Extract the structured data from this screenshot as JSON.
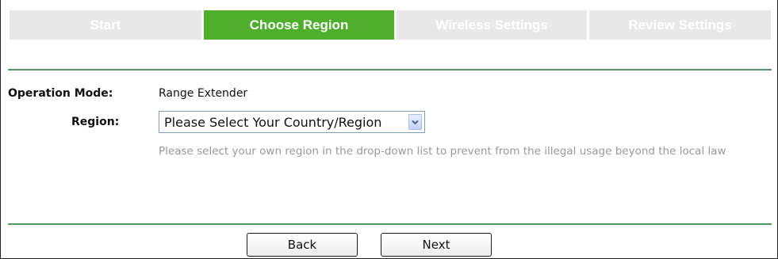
{
  "tabs": [
    {
      "label": "Start",
      "active": false
    },
    {
      "label": "Choose Region",
      "active": true
    },
    {
      "label": "Wireless Settings",
      "active": false
    },
    {
      "label": "Review Settings",
      "active": false
    }
  ],
  "form": {
    "operation_mode_label": "Operation Mode:",
    "operation_mode_value": "Range Extender",
    "region_label": "Region:",
    "region_selected": "Please Select Your Country/Region",
    "region_hint": "Please select your own region in the drop-down list to prevent from the illegal usage beyond the local law"
  },
  "buttons": {
    "back_label": "Back",
    "next_label": "Next"
  },
  "colors": {
    "active_tab": "#4faf2c",
    "inactive_tab": "#e8e8e8",
    "divider": "#4f9a62",
    "hint_text": "#999999"
  },
  "icons": {
    "dropdown": "chevron-down-icon"
  }
}
